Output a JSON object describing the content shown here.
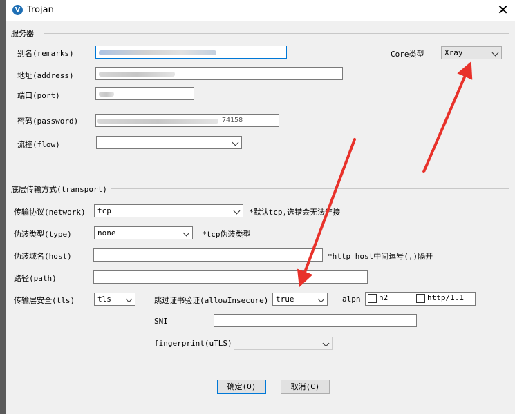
{
  "window": {
    "title": "Trojan",
    "icon": "v-logo-icon"
  },
  "server": {
    "group_label": "服务器",
    "remarks_label": "别名(remarks)",
    "address_label": "地址(address)",
    "port_label": "端口(port)",
    "password_label": "密码(password)",
    "password_partial": "74158",
    "flow_label": "流控(flow)",
    "flow_value": "",
    "core_label": "Core类型",
    "core_value": "Xray"
  },
  "transport": {
    "group_label": "底层传输方式(transport)",
    "network_label": "传输协议(network)",
    "network_value": "tcp",
    "network_hint": "*默认tcp,选错会无法连接",
    "type_label": "伪装类型(type)",
    "type_value": "none",
    "type_hint": "*tcp伪装类型",
    "host_label": "伪装域名(host)",
    "host_value": "",
    "host_hint": "*http host中间逗号(,)隔开",
    "path_label": "路径(path)",
    "path_value": "",
    "tls_label": "传输层安全(tls)",
    "tls_value": "tls",
    "allow_insecure_label": "跳过证书验证(allowInsecure)",
    "allow_insecure_value": "true",
    "alpn_label": "alpn",
    "alpn_options": [
      {
        "label": "h2",
        "checked": false
      },
      {
        "label": "http/1.1",
        "checked": false
      }
    ],
    "sni_label": "SNI",
    "sni_value": "",
    "fingerprint_label": "fingerprint(uTLS)",
    "fingerprint_value": ""
  },
  "buttons": {
    "ok": "确定(O)",
    "cancel": "取消(C)"
  },
  "colors": {
    "accent": "#0078d7",
    "arrow": "#e8312a"
  }
}
